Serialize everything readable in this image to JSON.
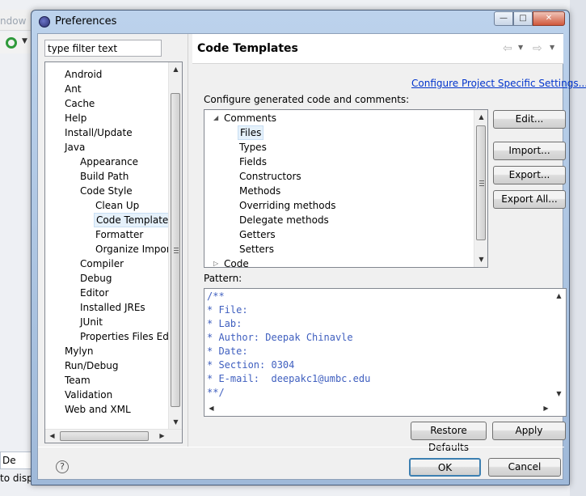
{
  "background": {
    "menu_fragment": "ndow",
    "bottom_tab_label": "De",
    "bottom_status_fragment": "to displ"
  },
  "dialog": {
    "title": "Preferences",
    "window_buttons": {
      "minimize": "—",
      "maximize": "□",
      "close": "✕"
    }
  },
  "filter": {
    "value": "type filter text"
  },
  "tree": [
    {
      "label": "Android",
      "depth": 1
    },
    {
      "label": "Ant",
      "depth": 1
    },
    {
      "label": "Cache",
      "depth": 1
    },
    {
      "label": "Help",
      "depth": 1
    },
    {
      "label": "Install/Update",
      "depth": 1
    },
    {
      "label": "Java",
      "depth": 1
    },
    {
      "label": "Appearance",
      "depth": 2
    },
    {
      "label": "Build Path",
      "depth": 2
    },
    {
      "label": "Code Style",
      "depth": 2
    },
    {
      "label": "Clean Up",
      "depth": 3
    },
    {
      "label": "Code Templates",
      "depth": 3,
      "selected": true
    },
    {
      "label": "Formatter",
      "depth": 3
    },
    {
      "label": "Organize Imports",
      "depth": 3
    },
    {
      "label": "Compiler",
      "depth": 2
    },
    {
      "label": "Debug",
      "depth": 2
    },
    {
      "label": "Editor",
      "depth": 2
    },
    {
      "label": "Installed JREs",
      "depth": 2
    },
    {
      "label": "JUnit",
      "depth": 2
    },
    {
      "label": "Properties Files Editor",
      "depth": 2
    },
    {
      "label": "Mylyn",
      "depth": 1
    },
    {
      "label": "Run/Debug",
      "depth": 1
    },
    {
      "label": "Team",
      "depth": 1
    },
    {
      "label": "Validation",
      "depth": 1
    },
    {
      "label": "Web and XML",
      "depth": 1
    }
  ],
  "page": {
    "title": "Code Templates",
    "config_link": "Configure Project Specific Settings...",
    "description": "Configure generated code and comments:",
    "templates": [
      {
        "label": "Comments",
        "level": 0,
        "expander": "◢"
      },
      {
        "label": "Files",
        "level": 1,
        "selected": true
      },
      {
        "label": "Types",
        "level": 1
      },
      {
        "label": "Fields",
        "level": 1
      },
      {
        "label": "Constructors",
        "level": 1
      },
      {
        "label": "Methods",
        "level": 1
      },
      {
        "label": "Overriding methods",
        "level": 1
      },
      {
        "label": "Delegate methods",
        "level": 1
      },
      {
        "label": "Getters",
        "level": 1
      },
      {
        "label": "Setters",
        "level": 1
      },
      {
        "label": "Code",
        "level": 0,
        "expander": "▷"
      }
    ],
    "buttons": {
      "edit": "Edit...",
      "import": "Import...",
      "export": "Export...",
      "export_all": "Export All..."
    },
    "pattern_label": "Pattern:",
    "pattern_lines": [
      "/**",
      "* File:",
      "* Lab:",
      "* Author: Deepak Chinavle",
      "* Date:",
      "* Section: 0304",
      "* E-mail:  deepakc1@umbc.edu",
      "**/"
    ],
    "restore_defaults": "Restore Defaults",
    "apply": "Apply"
  },
  "footer": {
    "help": "?",
    "ok": "OK",
    "cancel": "Cancel"
  },
  "icons": {
    "back": "⇦",
    "forward": "⇨",
    "dropdown": "▼",
    "scroll_up": "▲",
    "scroll_down": "▼",
    "scroll_left": "◀",
    "scroll_right": "▶"
  },
  "colors": {
    "link": "#0033cc",
    "pattern_text": "#3f5fbf",
    "selection": "#e5f1fb"
  }
}
